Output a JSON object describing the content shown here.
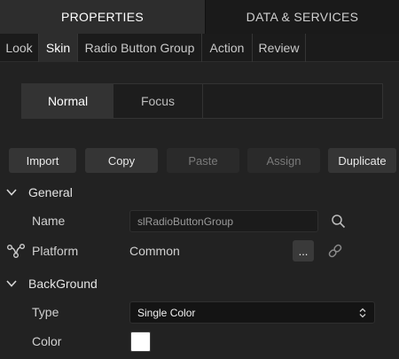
{
  "top_tabs": {
    "properties": "PROPERTIES",
    "data_services": "DATA & SERVICES"
  },
  "sub_tabs": [
    "Look",
    "Skin",
    "Radio Button Group",
    "Action",
    "Review"
  ],
  "state_tabs": {
    "normal": "Normal",
    "focus": "Focus"
  },
  "actions": {
    "import": "Import",
    "copy": "Copy",
    "paste": "Paste",
    "assign": "Assign",
    "duplicate": "Duplicate"
  },
  "general": {
    "title": "General",
    "name_label": "Name",
    "name_value": "slRadioButtonGroup",
    "platform_label": "Platform",
    "platform_value": "Common",
    "more_label": "..."
  },
  "background": {
    "title": "BackGround",
    "type_label": "Type",
    "type_value": "Single Color",
    "color_label": "Color",
    "color_value": "#ffffff"
  }
}
